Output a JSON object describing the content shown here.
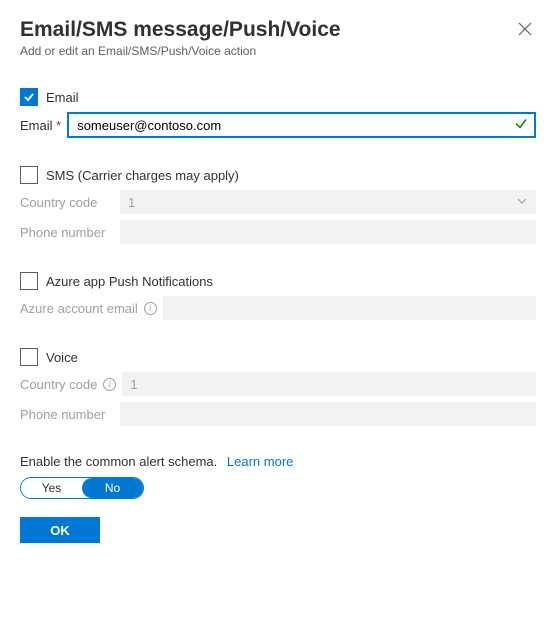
{
  "header": {
    "title": "Email/SMS message/Push/Voice",
    "subtitle": "Add or edit an Email/SMS/Push/Voice action"
  },
  "email": {
    "cb_label": "Email",
    "field_label": "Email",
    "value": "someuser@contoso.com"
  },
  "sms": {
    "cb_label": "SMS (Carrier charges may apply)",
    "country_label": "Country code",
    "country_value": "1",
    "phone_label": "Phone number"
  },
  "push": {
    "cb_label": "Azure app Push Notifications",
    "account_label": "Azure account email"
  },
  "voice": {
    "cb_label": "Voice",
    "country_label": "Country code",
    "country_value": "1",
    "phone_label": "Phone number"
  },
  "schema": {
    "text": "Enable the common alert schema.",
    "link": "Learn more",
    "yes": "Yes",
    "no": "No"
  },
  "ok": "OK"
}
